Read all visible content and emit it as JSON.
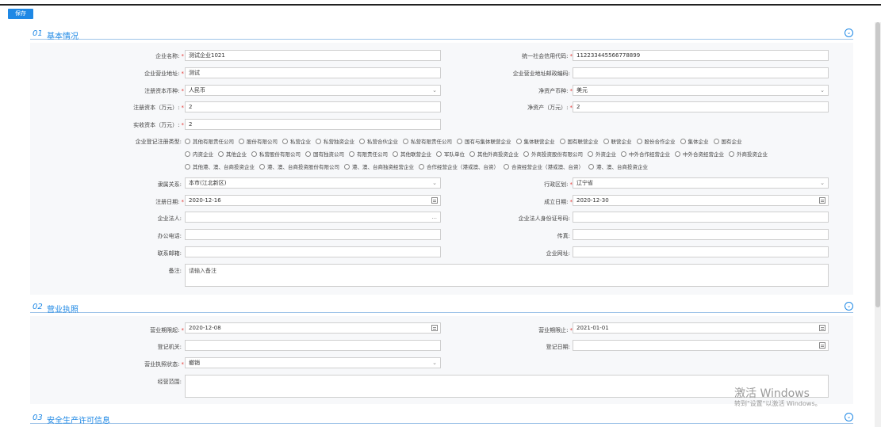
{
  "toolbar": {
    "save_label": "保存"
  },
  "sections": [
    {
      "num": "01",
      "title": "基本情况"
    },
    {
      "num": "02",
      "title": "营业执照"
    },
    {
      "num": "03",
      "title": "安全生产许可信息"
    }
  ],
  "basic": {
    "company_name": {
      "label": "企业名称:",
      "value": "测试企业1021"
    },
    "credit_code": {
      "label": "统一社会信用代码:",
      "value": "112233445566778899"
    },
    "address": {
      "label": "企业营业地址:",
      "value": "测试"
    },
    "postcode": {
      "label": "企业营业地址邮政编码:",
      "value": ""
    },
    "reg_currency": {
      "label": "注册资本币种:",
      "value": "人民币"
    },
    "net_currency": {
      "label": "净资产币种:",
      "value": "美元"
    },
    "reg_capital": {
      "label": "注册资本（万元）:",
      "value": "2"
    },
    "net_assets": {
      "label": "净资产（万元）:",
      "value": "2"
    },
    "paid_capital": {
      "label": "实收资本（万元）:",
      "value": "2"
    },
    "reg_type_label": "企业登记注册类型:",
    "reg_types_row1": [
      "其他有限责任公司",
      "股份有限公司",
      "私营企业",
      "私营独资企业",
      "私营合伙企业",
      "私营有限责任公司",
      "国有与集体联营企业",
      "集体联营企业",
      "国有联营企业",
      "联营企业",
      "股份合作企业",
      "集体企业",
      "国有企业"
    ],
    "reg_types_row2": [
      "内资企业",
      "其他企业",
      "私营股份有限公司",
      "国有独资公司",
      "有限责任公司",
      "其他联营企业",
      "军队单位",
      "其他外商投资企业",
      "外商投资股份有限公司",
      "外资企业",
      "中外合作经营企业",
      "中外合资经营企业",
      "外商投资企业"
    ],
    "reg_types_row3": [
      "其他港、澳、台商投资企业",
      "港、澳、台商投资股份有限公司",
      "港、澳、台商独资经营企业",
      "合作经营企业（港或澳、台资）",
      "合资经营企业（港或澳、台资）",
      "港、澳、台商投资企业"
    ],
    "affiliation": {
      "label": "隶属关系:",
      "value": "本市(江北新区)"
    },
    "region": {
      "label": "行政区划:",
      "value": "辽宁省"
    },
    "reg_date": {
      "label": "注册日期:",
      "value": "2020-12-16"
    },
    "est_date": {
      "label": "成立日期:",
      "value": "2020-12-30"
    },
    "legal_person": {
      "label": "企业法人:",
      "value": "",
      "suffix": "..."
    },
    "legal_id": {
      "label": "企业法人身份证号码:",
      "value": ""
    },
    "office_phone": {
      "label": "办公电话:",
      "value": ""
    },
    "fax": {
      "label": "传真:",
      "value": ""
    },
    "email": {
      "label": "联系邮箱:",
      "value": ""
    },
    "website": {
      "label": "企业网址:",
      "value": ""
    },
    "remark": {
      "label": "备注:",
      "placeholder": "请输入备注"
    }
  },
  "license": {
    "start": {
      "label": "营业期限起:",
      "value": "2020-12-08"
    },
    "end": {
      "label": "营业期限止:",
      "value": "2021-01-01"
    },
    "authority": {
      "label": "登记机关:",
      "value": ""
    },
    "reg_date": {
      "label": "登记日期:",
      "value": ""
    },
    "status": {
      "label": "营业执照状态:",
      "value": "撤销"
    },
    "scope": {
      "label": "经营范围:",
      "value": ""
    }
  },
  "watermark": {
    "line1": "激活 Windows",
    "line2": "转到\"设置\"以激活 Windows。"
  }
}
